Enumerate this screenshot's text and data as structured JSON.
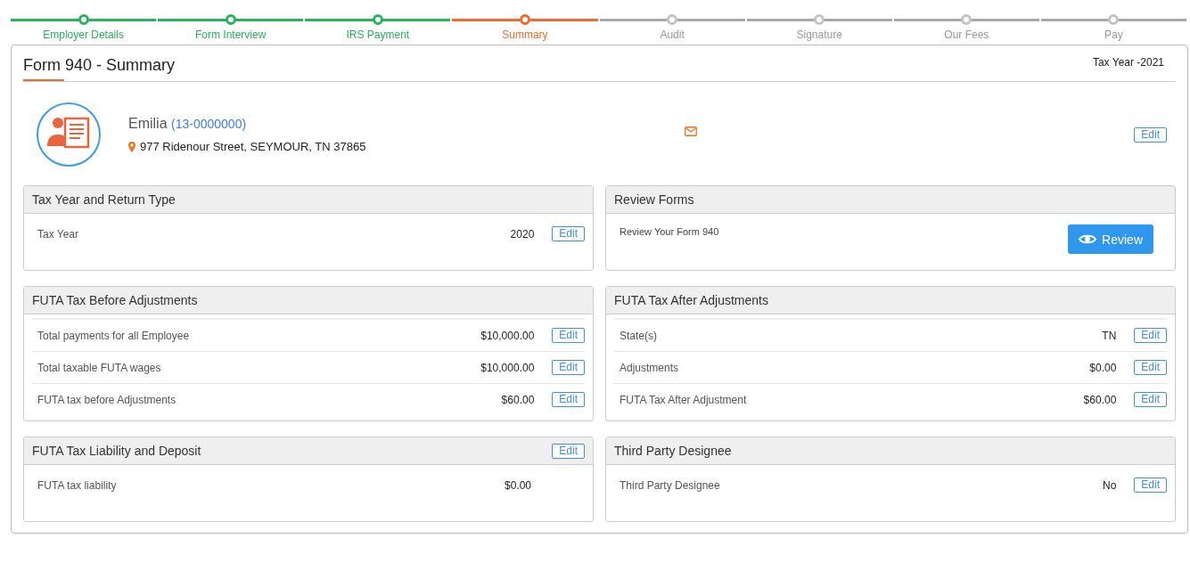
{
  "steps": [
    {
      "label": "Employer Details",
      "completed": true,
      "current": false
    },
    {
      "label": "Form Interview",
      "completed": true,
      "current": false
    },
    {
      "label": "IRS Payment",
      "completed": true,
      "current": false
    },
    {
      "label": "Summary",
      "completed": false,
      "current": true
    },
    {
      "label": "Audit",
      "completed": false,
      "current": false
    },
    {
      "label": "Signature",
      "completed": false,
      "current": false
    },
    {
      "label": "Our Fees",
      "completed": false,
      "current": false
    },
    {
      "label": "Pay",
      "completed": false,
      "current": false
    }
  ],
  "page": {
    "title": "Form 940 - Summary",
    "tax_year": "Tax Year -2021"
  },
  "employer": {
    "name": "Emilia",
    "ein": "(13-0000000)",
    "address": "977 Ridenour Street, SEYMOUR, TN 37865",
    "edit": "Edit"
  },
  "sections": [
    {
      "kind": "rows",
      "title": "Tax Year and Return Type",
      "rows": [
        {
          "label": "Tax Year",
          "value": "2020",
          "edit": "Edit"
        }
      ]
    },
    {
      "kind": "review",
      "title": "Review Forms",
      "text": "Review Your Form 940",
      "button": "Review"
    },
    {
      "kind": "rows",
      "title": "FUTA Tax Before Adjustments",
      "rows": [
        {
          "label": "Total payments for all Employee",
          "value": "$10,000.00",
          "edit": "Edit"
        },
        {
          "label": "Total taxable FUTA wages",
          "value": "$10,000.00",
          "edit": "Edit"
        },
        {
          "label": "FUTA tax before Adjustments",
          "value": "$60.00",
          "edit": "Edit"
        }
      ]
    },
    {
      "kind": "rows",
      "title": "FUTA Tax After Adjustments",
      "rows": [
        {
          "label": "State(s)",
          "value": "TN",
          "edit": "Edit"
        },
        {
          "label": "Adjustments",
          "value": "$0.00",
          "edit": "Edit"
        },
        {
          "label": "FUTA Tax After Adjustment",
          "value": "$60.00",
          "edit": "Edit"
        }
      ]
    },
    {
      "kind": "rows",
      "title": "FUTA Tax Liability and Deposit",
      "header_edit": "Edit",
      "rows": [
        {
          "label": "FUTA tax liability",
          "value": "$0.00"
        }
      ]
    },
    {
      "kind": "rows",
      "title": "Third Party Designee",
      "rows": [
        {
          "label": "Third Party Designee",
          "value": "No",
          "edit": "Edit"
        }
      ]
    }
  ]
}
